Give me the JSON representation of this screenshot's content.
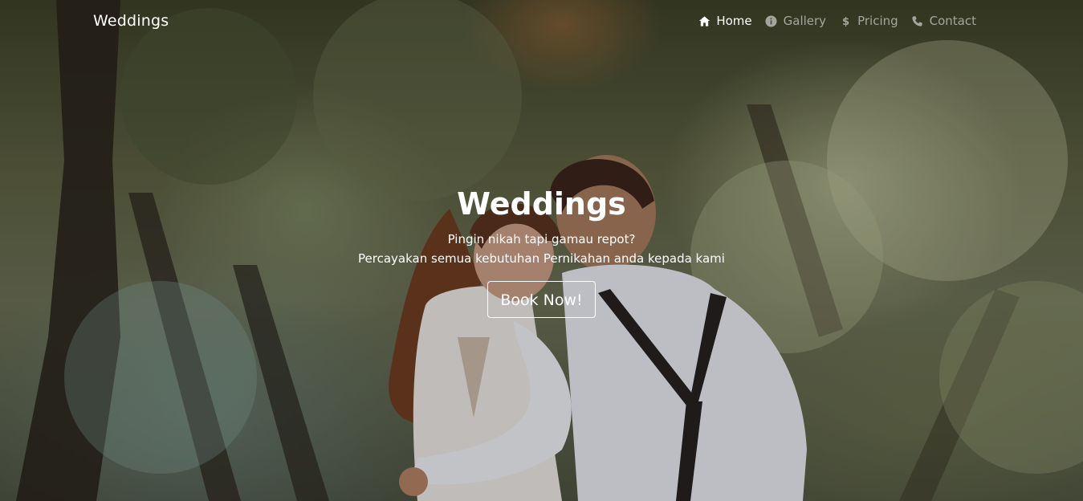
{
  "navbar": {
    "brand": "Weddings",
    "items": [
      {
        "label": "Home",
        "icon": "home-icon",
        "active": true
      },
      {
        "label": "Gallery",
        "icon": "info-circle-icon",
        "active": false
      },
      {
        "label": "Pricing",
        "icon": "dollar-icon",
        "active": false
      },
      {
        "label": "Contact",
        "icon": "phone-icon",
        "active": false
      }
    ]
  },
  "hero": {
    "title": "Weddings",
    "subtitle_line1": "Pingin nikah tapi gamau repot?",
    "subtitle_line2": "Percayakan semua kebutuhan Pernikahan anda kepada kami",
    "cta": "Book Now!"
  },
  "colors": {
    "text": "#ffffff",
    "nav_inactive": "rgba(255,255,255,0.55)"
  }
}
